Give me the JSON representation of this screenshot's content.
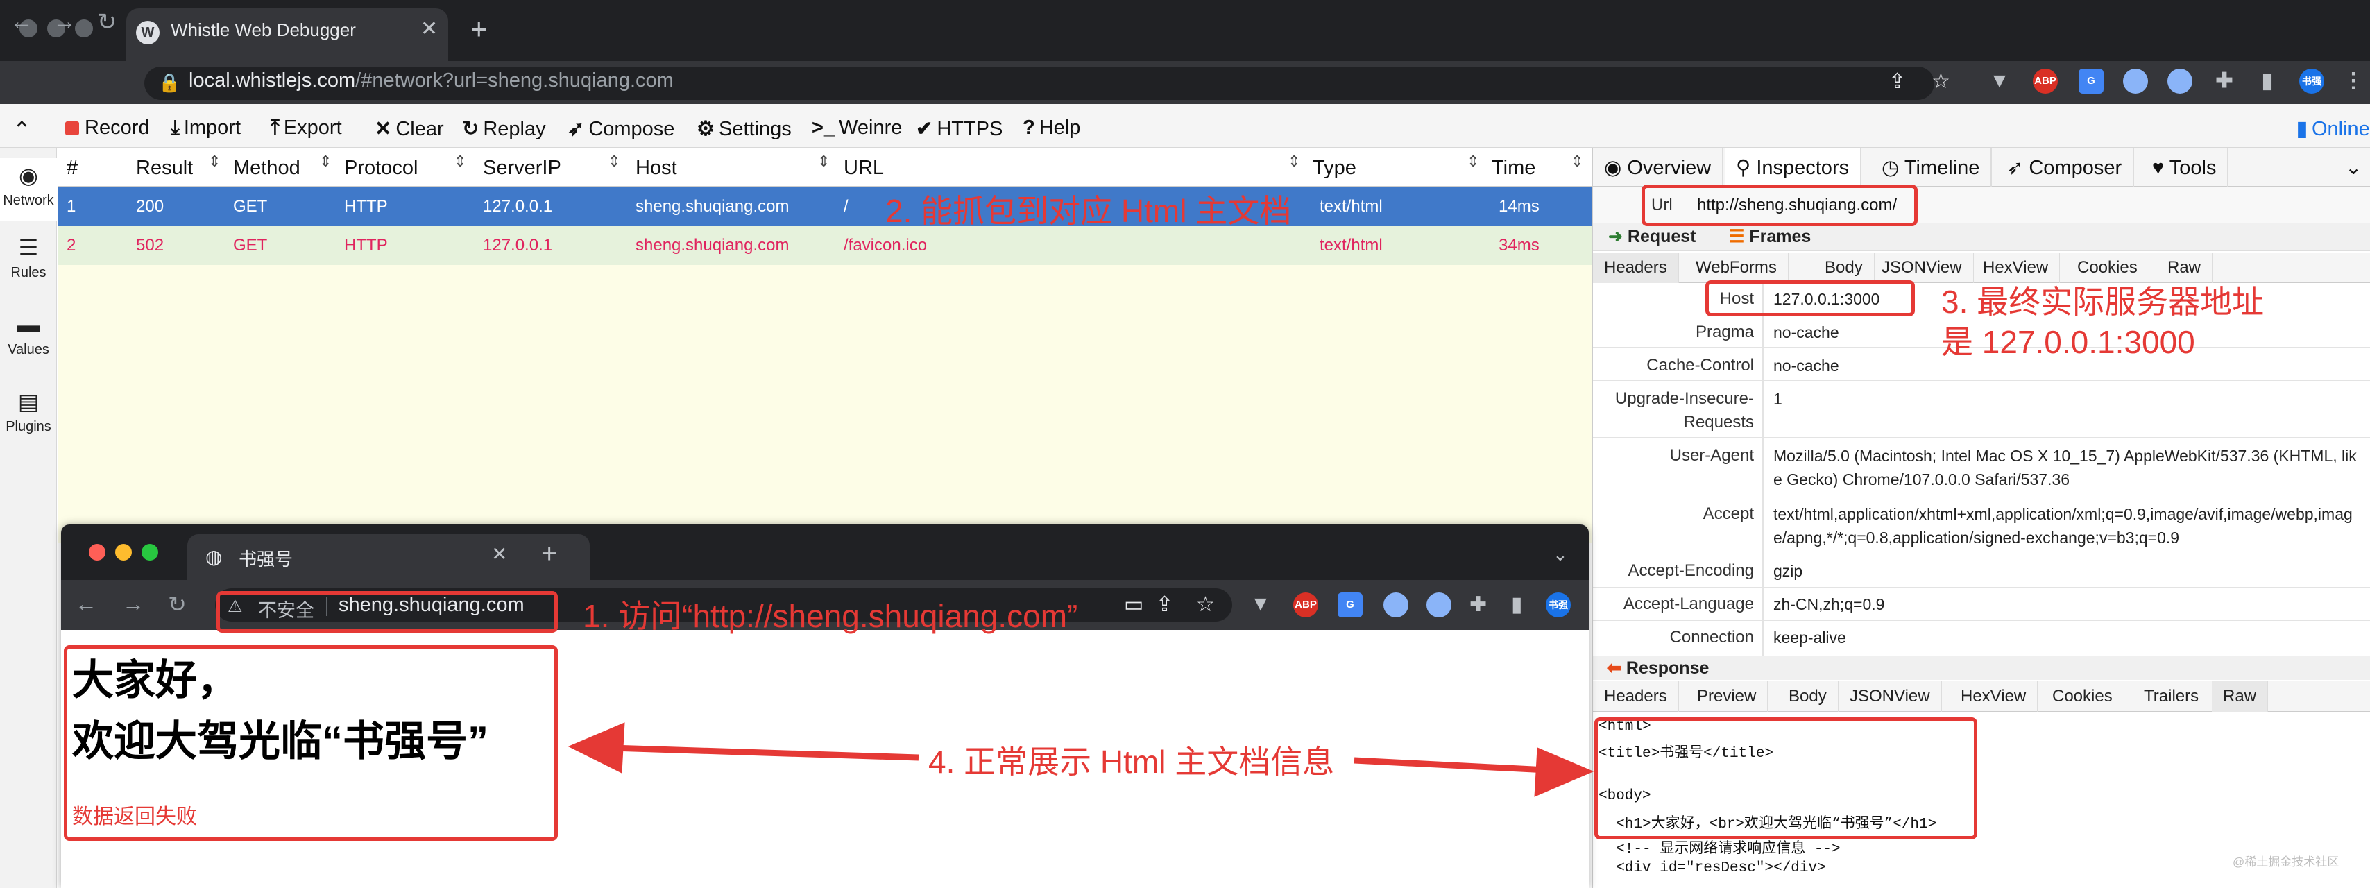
{
  "browser": {
    "tab_title": "Whistle Web Debugger",
    "favicon_letter": "W",
    "address_host": "local.whistlejs.com",
    "address_rest": "/#network?url=sheng.shuqiang.com",
    "ext_abp": "ABP",
    "ext_gt": "G",
    "avatar": "书强",
    "online_label": "Online"
  },
  "toolbar": {
    "record": "Record",
    "import": "Import",
    "export": "Export",
    "clear": "Clear",
    "replay": "Replay",
    "compose": "Compose",
    "settings": "Settings",
    "weinre": "Weinre",
    "https": "HTTPS",
    "help": "Help"
  },
  "sidebar": {
    "items": [
      {
        "label": "Network"
      },
      {
        "label": "Rules"
      },
      {
        "label": "Values"
      },
      {
        "label": "Plugins"
      }
    ]
  },
  "network": {
    "columns": [
      "#",
      "Result",
      "Method",
      "Protocol",
      "ServerIP",
      "Host",
      "URL",
      "Type",
      "Time"
    ],
    "rows": [
      {
        "num": "1",
        "result": "200",
        "method": "GET",
        "protocol": "HTTP",
        "server_ip": "127.0.0.1",
        "host": "sheng.shuqiang.com",
        "url": "/",
        "type": "text/html",
        "time": "14ms",
        "selected": true
      },
      {
        "num": "2",
        "result": "502",
        "method": "GET",
        "protocol": "HTTP",
        "server_ip": "127.0.0.1",
        "host": "sheng.shuqiang.com",
        "url": "/favicon.ico",
        "type": "text/html",
        "time": "34ms",
        "selected": false
      }
    ]
  },
  "inspector": {
    "tabs": [
      "Overview",
      "Inspectors",
      "Timeline",
      "Composer",
      "Tools"
    ],
    "active_tab": "Inspectors",
    "url_label": "Url",
    "url_value": "http://sheng.shuqiang.com/",
    "request_label": "Request",
    "frames_label": "Frames",
    "request_tabs": [
      "Headers",
      "WebForms",
      "Body",
      "JSONView",
      "HexView",
      "Cookies",
      "Raw"
    ],
    "headers": [
      {
        "name": "Host",
        "value": "127.0.0.1:3000"
      },
      {
        "name": "Pragma",
        "value": "no-cache"
      },
      {
        "name": "Cache-Control",
        "value": "no-cache"
      },
      {
        "name": "Upgrade-Insecure-Requests",
        "value": "1"
      },
      {
        "name": "User-Agent",
        "value": "Mozilla/5.0 (Macintosh; Intel Mac OS X 10_15_7) AppleWebKit/537.36 (KHTML, like Gecko) Chrome/107.0.0.0 Safari/537.36"
      },
      {
        "name": "Accept",
        "value": "text/html,application/xhtml+xml,application/xml;q=0.9,image/avif,image/webp,image/apng,*/*;q=0.8,application/signed-exchange;v=b3;q=0.9"
      },
      {
        "name": "Accept-Encoding",
        "value": "gzip"
      },
      {
        "name": "Accept-Language",
        "value": "zh-CN,zh;q=0.9"
      },
      {
        "name": "Connection",
        "value": "keep-alive"
      }
    ],
    "response_label": "Response",
    "response_tabs": [
      "Headers",
      "Preview",
      "Body",
      "JSONView",
      "HexView",
      "Cookies",
      "Trailers",
      "Raw"
    ],
    "response_body": [
      "<html>",
      "<title>书强号</title>",
      "",
      "<body>",
      "  <h1>大家好，<br>欢迎大驾光临“书强号”</h1>",
      "  <!-- 显示网络请求响应信息 -->",
      "  <div id=\"resDesc\"></div>"
    ]
  },
  "inner_browser": {
    "tab_title": "书强号",
    "insecure_label": "不安全",
    "address": "sheng.shuqiang.com",
    "avatar": "书强",
    "heading_line1": "大家好，",
    "heading_line2": "欢迎大驾光临“书强号”",
    "status_text": "数据返回失败"
  },
  "annotations": {
    "a1": "1. 访问“http://sheng.shuqiang.com”",
    "a2": "2. 能抓包到对应 Html 主文档",
    "a3_line1": "3. 最终实际服务器地址",
    "a3_line2": "是 127.0.0.1:3000",
    "a4": "4. 正常展示 Html 主文档信息"
  },
  "watermark": "@稀土掘金技术社区",
  "colors": {
    "selected_row": "#4079c9",
    "error_row_bg": "#e6f2dc",
    "error_text": "#e0245e",
    "annotation_red": "#e53935"
  }
}
